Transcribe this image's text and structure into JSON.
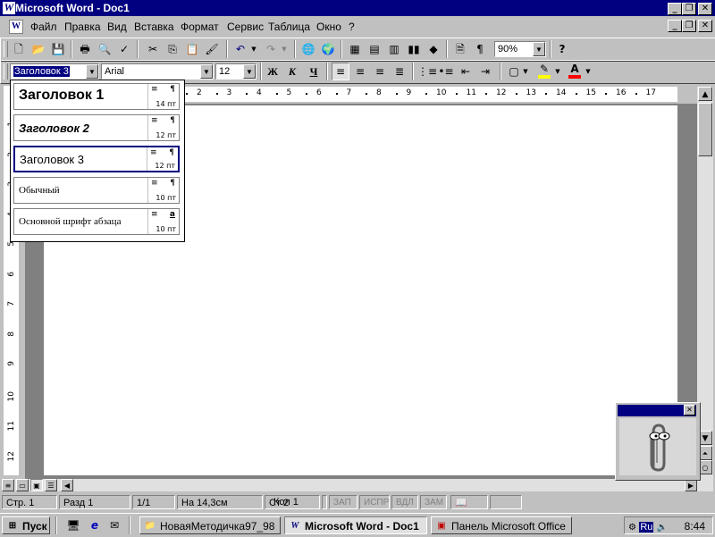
{
  "titlebar": {
    "title": "Microsoft Word - Doc1",
    "icon": "W"
  },
  "menubar": {
    "items": [
      "Файл",
      "Правка",
      "Вид",
      "Вставка",
      "Формат",
      "Сервис",
      "Таблица",
      "Окно",
      "?"
    ]
  },
  "standard_toolbar": {
    "zoom": "90%"
  },
  "formatting_toolbar": {
    "style": "Заголовок 3",
    "font": "Arial",
    "size": "12",
    "bold": "Ж",
    "italic": "К",
    "underline": "Ч"
  },
  "style_dropdown": {
    "items": [
      {
        "name": "Заголовок 1",
        "size": "14 пт",
        "mark": "¶"
      },
      {
        "name": "Заголовок 2",
        "size": "12 пт",
        "mark": "¶"
      },
      {
        "name": "Заголовок 3",
        "size": "12 пт",
        "mark": "¶"
      },
      {
        "name": "Обычный",
        "size": "10 пт",
        "mark": "¶"
      },
      {
        "name": "Основной шрифт абзаца",
        "size": "10 пт",
        "mark": "a"
      }
    ]
  },
  "ruler": {
    "h_numbers": [
      "2",
      "3",
      "4",
      "5",
      "6",
      "7",
      "8",
      "9",
      "10",
      "11",
      "12",
      "13",
      "14",
      "15",
      "16",
      "17"
    ],
    "v_numbers": [
      "1",
      "2",
      "3",
      "4",
      "5",
      "6",
      "7",
      "8",
      "9",
      "10",
      "11",
      "12"
    ]
  },
  "statusbar": {
    "page": "Стр. 1",
    "section": "Разд 1",
    "pages": "1/1",
    "position": "На 14,3см",
    "line": "Ст 2",
    "col": "Кол 1",
    "rec": "ЗАП",
    "trk": "ИСПР",
    "ext": "ВДЛ",
    "ovr": "ЗАМ"
  },
  "taskbar": {
    "start": "Пуск",
    "tasks": [
      "НоваяМетодичка97_98",
      "Microsoft Word - Doc1",
      "Панель Microsoft Office"
    ],
    "lang": "Ru",
    "clock": "8:44"
  },
  "colors": {
    "titlebar": "#000080",
    "highlight": "#ffff00",
    "font_color": "#ff0000"
  }
}
